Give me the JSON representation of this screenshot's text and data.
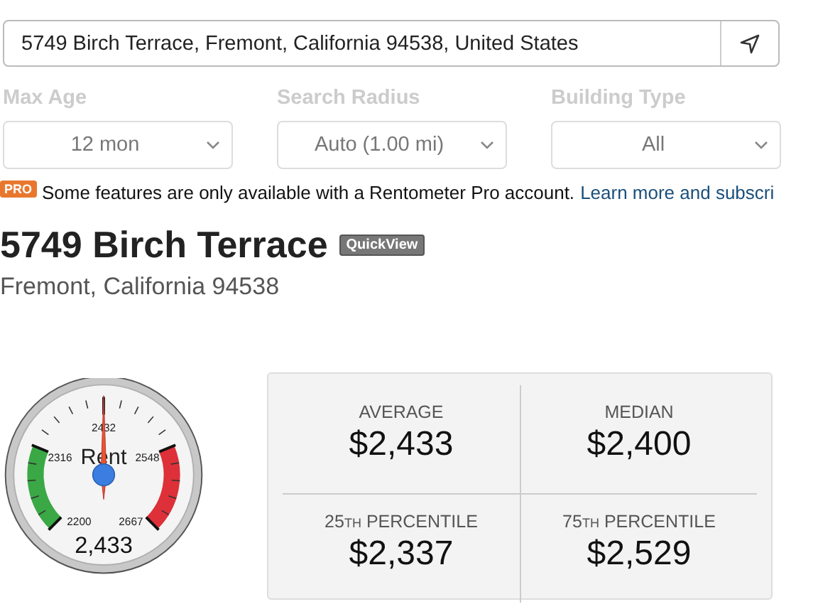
{
  "address": {
    "value": "5749 Birch Terrace, Fremont, California 94538, United States"
  },
  "filters": [
    {
      "label": "Max Age",
      "value": "12 mon",
      "disabled": true
    },
    {
      "label": "Search Radius",
      "value": "Auto (1.00 mi)",
      "disabled": true
    },
    {
      "label": "Building Type",
      "value": "All",
      "disabled": true
    }
  ],
  "pro_notice": {
    "badge": "PRO",
    "text": "Some features are only available with a Rentometer Pro account.",
    "link": "Learn more and subscri"
  },
  "property": {
    "title": "5749 Birch Terrace",
    "badge": "QuickView",
    "subtitle": "Fremont, California 94538"
  },
  "gauge": {
    "label": "Rent",
    "reading": "2,433",
    "ticks": [
      "2200",
      "2316",
      "2432",
      "2548",
      "2667"
    ]
  },
  "stats": [
    {
      "label": "AVERAGE",
      "value": "$2,433"
    },
    {
      "label": "MEDIAN",
      "value": "$2,400"
    },
    {
      "ordinal": "25",
      "suffix": "TH",
      "label": "PERCENTILE",
      "value": "$2,337"
    },
    {
      "ordinal": "75",
      "suffix": "TH",
      "label": "PERCENTILE",
      "value": "$2,529"
    }
  ]
}
